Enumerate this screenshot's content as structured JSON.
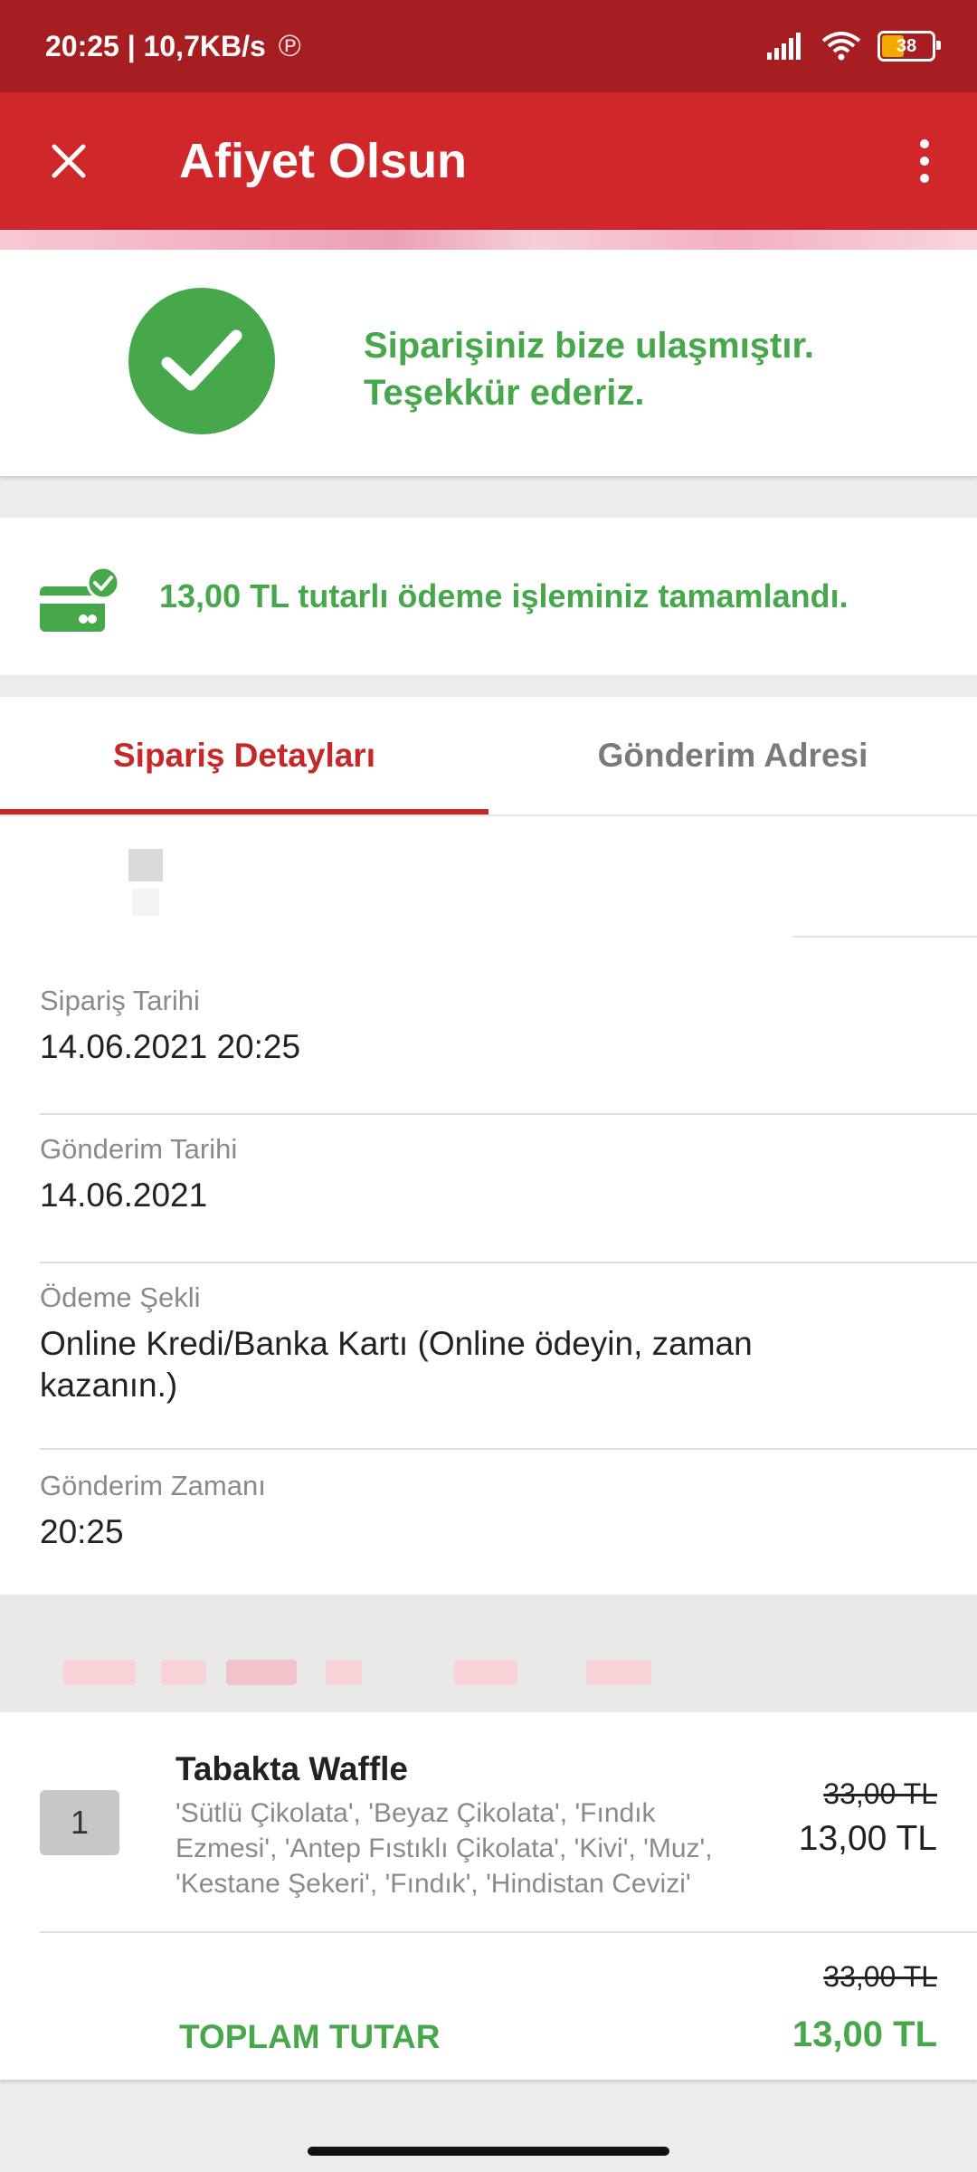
{
  "status_bar": {
    "time_speed": "20:25 | 10,7KB/s",
    "battery_level": "38",
    "icons": [
      "p-icon",
      "signal-icon",
      "wifi-icon",
      "battery-icon"
    ]
  },
  "app_bar": {
    "title": "Afiyet Olsun",
    "close_icon": "close-icon",
    "menu_icon": "more-vert-icon"
  },
  "success": {
    "line1": "Siparişiniz bize ulaşmıştır.",
    "line2": "Teşekkür ederiz.",
    "icon": "check-circle-icon",
    "color": "#47a84b"
  },
  "payment": {
    "message": "13,00 TL tutarlı ödeme işleminiz tamamlandı.",
    "icon": "credit-card-check-icon"
  },
  "tabs": [
    {
      "label": "Sipariş Detayları",
      "active": true
    },
    {
      "label": "Gönderim Adresi",
      "active": false
    }
  ],
  "details": [
    {
      "label": "Sipariş Tarihi",
      "value": "14.06.2021 20:25"
    },
    {
      "label": "Gönderim Tarihi",
      "value": "14.06.2021"
    },
    {
      "label": "Ödeme Şekli",
      "value": "Online Kredi/Banka Kartı (Online ödeyin, zaman kazanın.)"
    },
    {
      "label": "Gönderim Zamanı",
      "value": "20:25"
    }
  ],
  "items": [
    {
      "quantity": "1",
      "name": "Tabakta Waffle",
      "options": "'Sütlü Çikolata', 'Beyaz Çikolata', 'Fındık Ezmesi', 'Antep Fıstıklı Çikolata', 'Kivi', 'Muz', 'Kestane Şekeri', 'Fındık', 'Hindistan Cevizi'",
      "old_price": "33,00 TL",
      "price": "13,00 TL"
    }
  ],
  "total": {
    "label": "TOPLAM TUTAR",
    "old_price": "33,00 TL",
    "price": "13,00 TL"
  },
  "colors": {
    "status_bar": "#a61e22",
    "app_bar": "#d0272b",
    "accent_red": "#c62828",
    "success_green": "#47a84b"
  }
}
